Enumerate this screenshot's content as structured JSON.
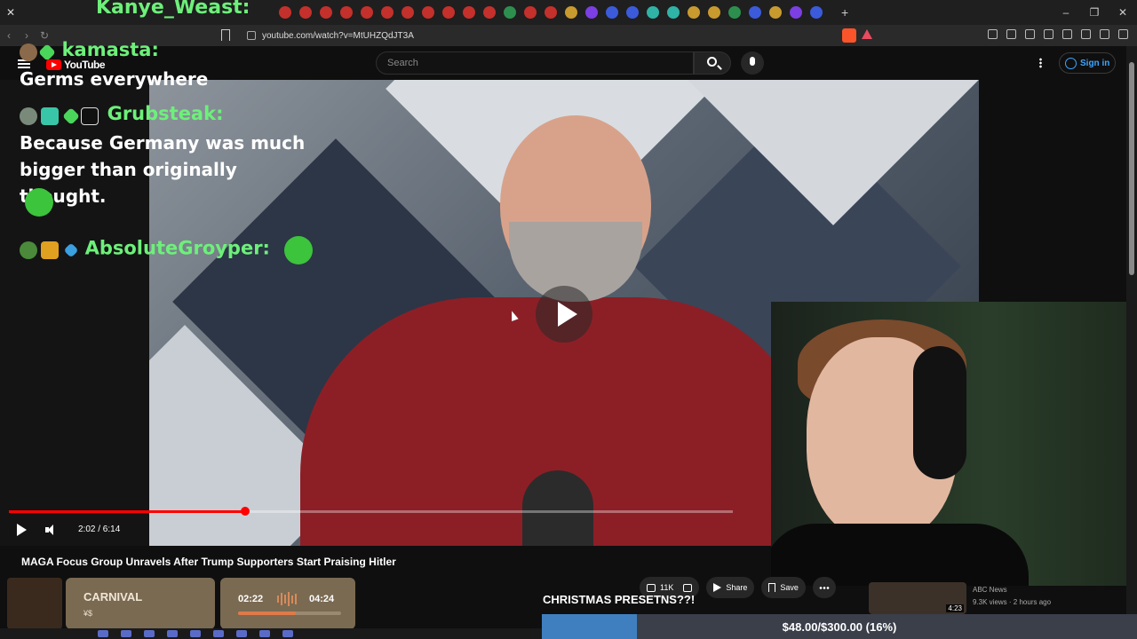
{
  "browser": {
    "top_username": "Kanye_Weast:",
    "url": "youtube.com/watch?v=MtUHZQdJT3A",
    "window_controls": [
      "–",
      "❐",
      "✕"
    ],
    "new_tab": "+"
  },
  "header": {
    "logo_text": "YouTube",
    "search_placeholder": "Search",
    "signin_label": "Sign in"
  },
  "chat": [
    {
      "user": "kamasta:",
      "message": "Germs everywhere"
    },
    {
      "user": "Grubsteak:",
      "message": "Because Germany was much bigger than originally thought."
    },
    {
      "user": "AbsoluteGroyper:",
      "message": ""
    }
  ],
  "player": {
    "time_current": "2:02",
    "time_total": "6:14",
    "time_display": "2:02 / 6:14",
    "progress": 0.326
  },
  "video": {
    "title": "MAGA Focus Group Unravels After Trump Supporters Start Praising Hitler",
    "likes": "11K",
    "share_label": "Share",
    "save_label": "Save"
  },
  "music": {
    "title": "CARNIVAL",
    "artist": "¥$",
    "current": "02:22",
    "total": "04:24",
    "progress": 0.56
  },
  "stream_text": "CHRISTMAS PRESETNS??!",
  "donation": {
    "text": "$48.00/$300.00 (16%)",
    "progress": 0.16
  },
  "recommendation": {
    "channel": "ABC News",
    "meta": "9.3K views · 2 hours ago",
    "duration": "4:23"
  },
  "colors": {
    "yt_red": "#ff0000",
    "chat_green": "#6df07a",
    "link_blue": "#3ea6ff"
  }
}
